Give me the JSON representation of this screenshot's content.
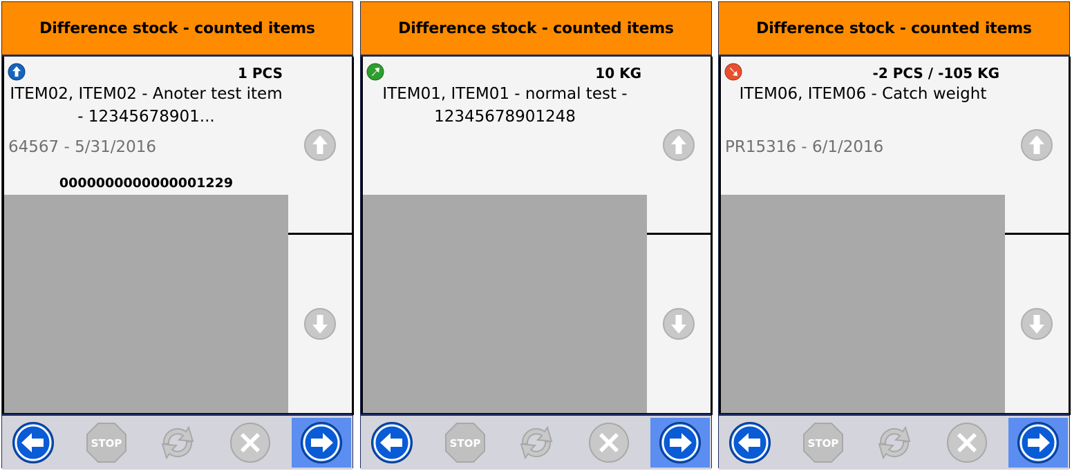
{
  "colors": {
    "header": "#ff8c00",
    "border": "#1c2b5e",
    "item_bg": "#f4f4f4",
    "empty_bg": "#a9a9a9",
    "toolbar_bg": "#d4d4dc",
    "active": "#5b8ef0"
  },
  "panels": [
    {
      "header": "Difference stock - counted items",
      "status_icon": "arrow-up-blue-icon",
      "qty": "1 PCS",
      "description": "ITEM02, ITEM02 - Anoter test item - 12345678901...",
      "meta": "64567 - 5/31/2016",
      "barcode": "0000000000000001229",
      "toolbar": [
        "back-icon",
        "stop-icon",
        "refresh-icon",
        "cancel-icon",
        "next-icon"
      ]
    },
    {
      "header": "Difference stock - counted items",
      "status_icon": "arrow-up-right-green-icon",
      "qty": "10 KG",
      "description": "ITEM01, ITEM01 - normal test - 12345678901248",
      "meta": "",
      "barcode": "",
      "toolbar": [
        "back-icon",
        "stop-icon",
        "refresh-icon",
        "cancel-icon",
        "next-icon"
      ]
    },
    {
      "header": "Difference stock - counted items",
      "status_icon": "arrow-down-right-red-icon",
      "qty": "-2 PCS / -105 KG",
      "description": "ITEM06, ITEM06 - Catch weight",
      "meta": "PR15316 - 6/1/2016",
      "barcode": "",
      "toolbar": [
        "back-icon",
        "stop-icon",
        "refresh-icon",
        "cancel-icon",
        "next-icon"
      ]
    }
  ]
}
